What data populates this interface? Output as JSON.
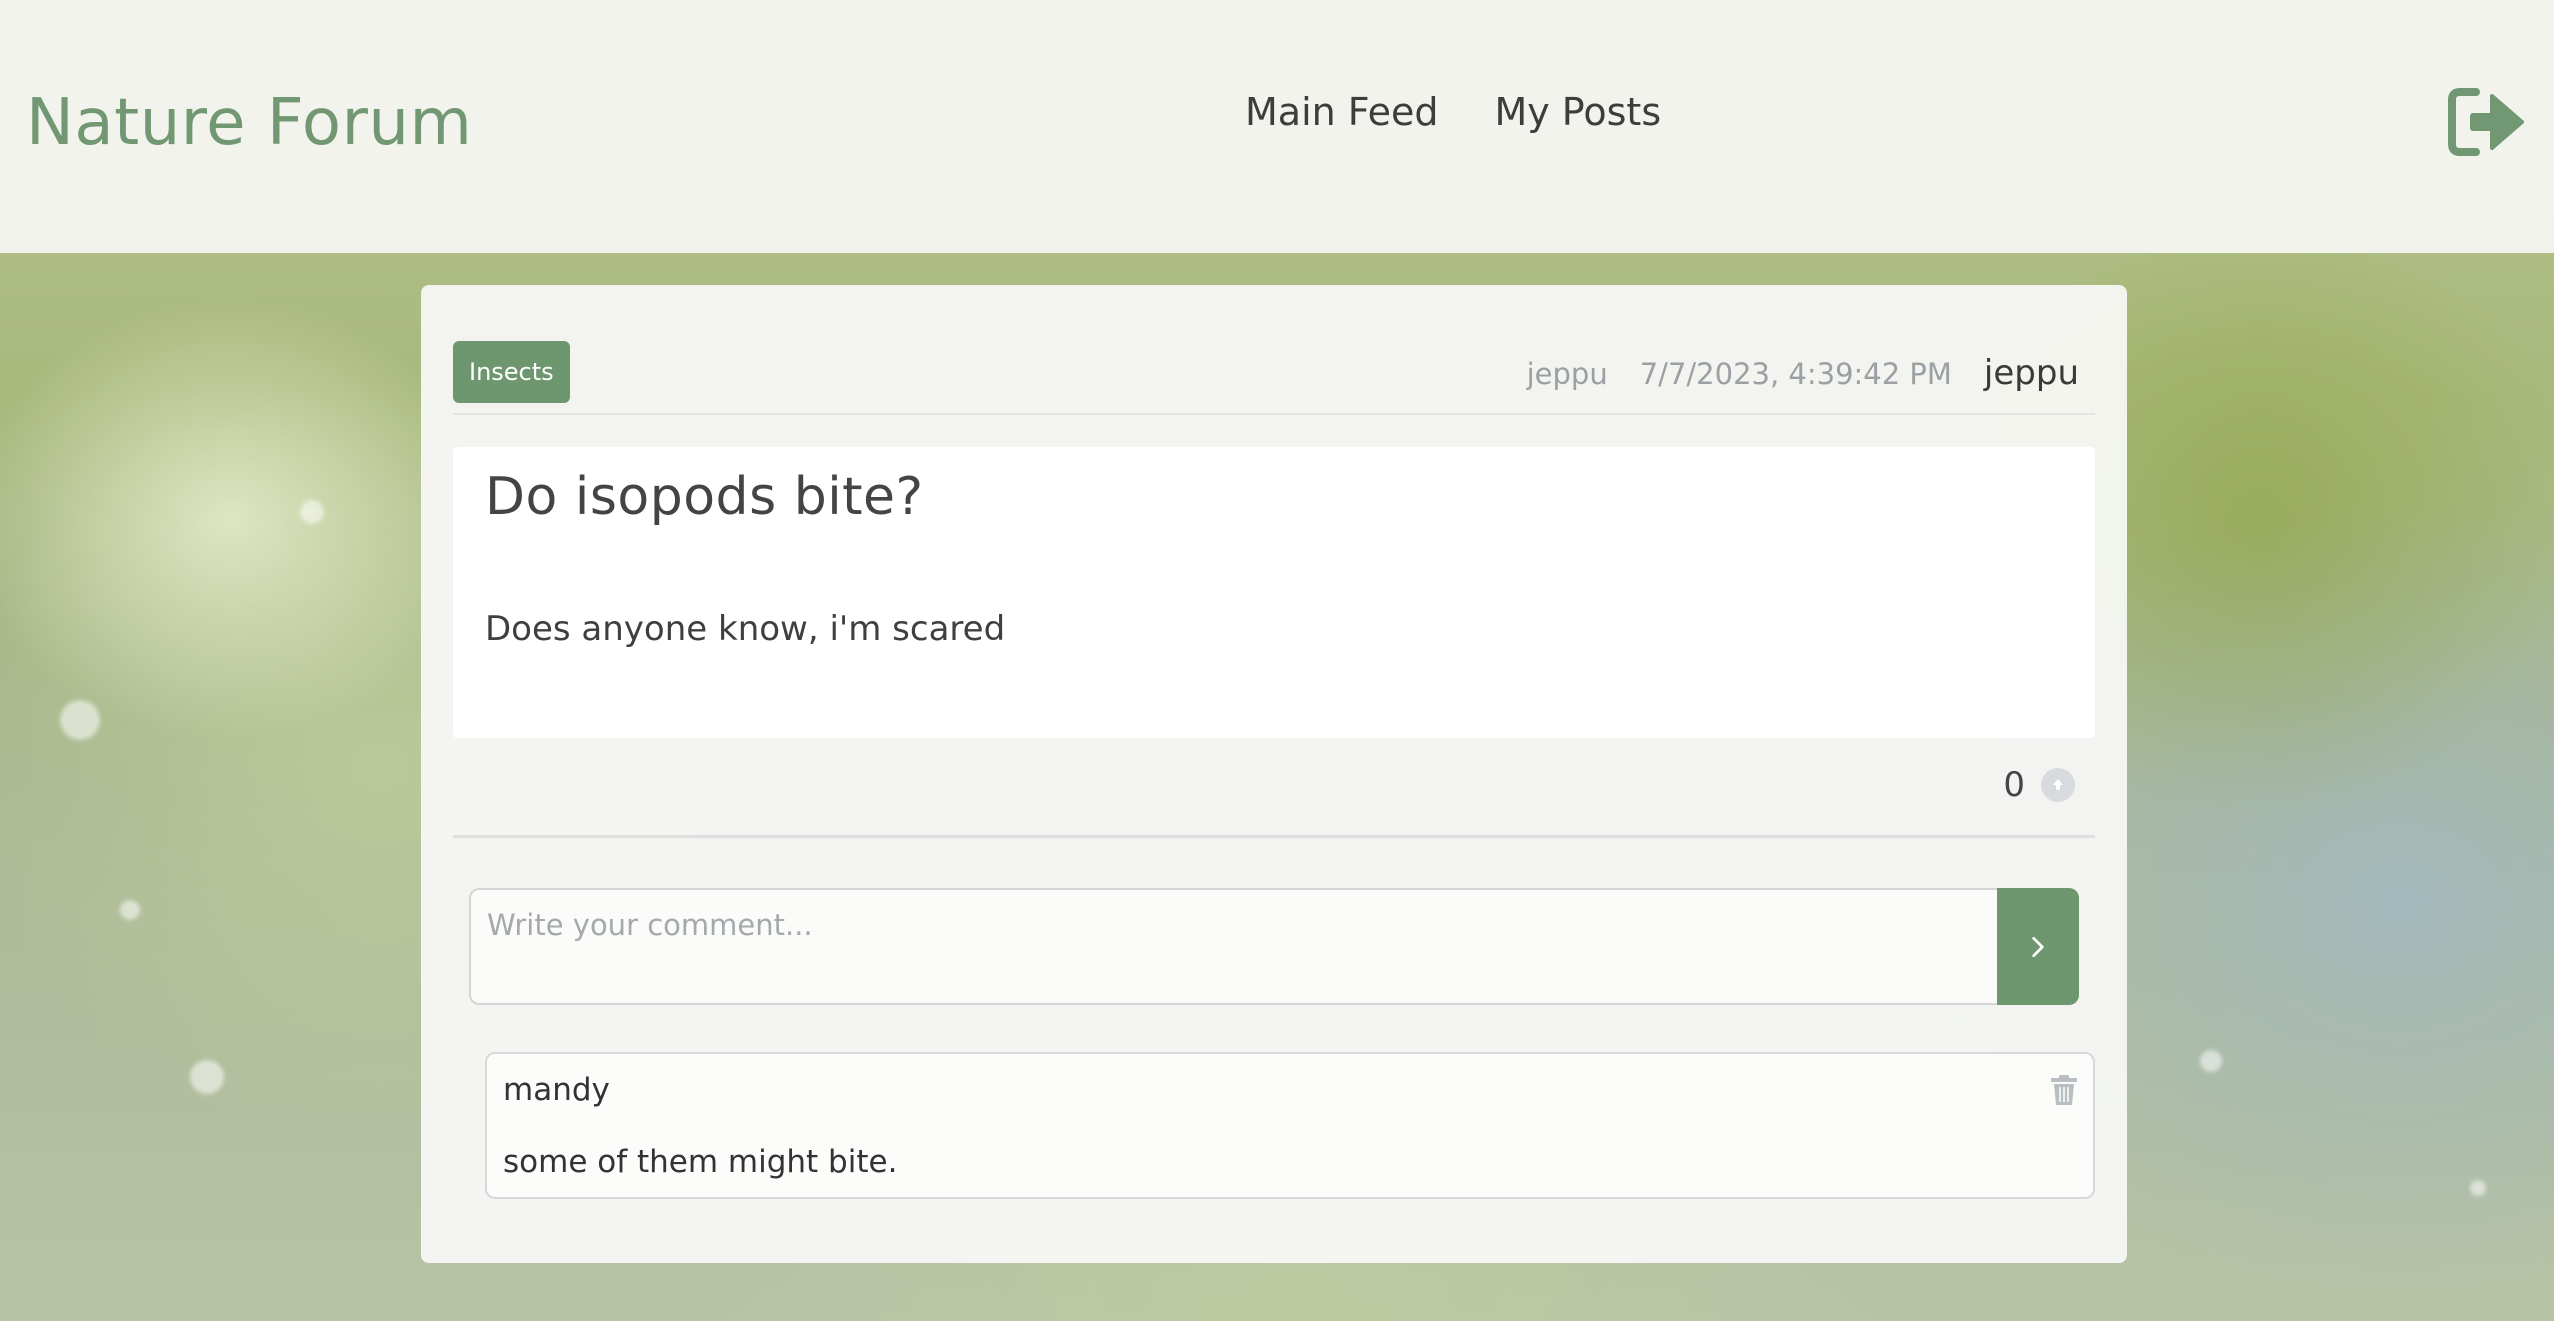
{
  "header": {
    "brand": "Nature Forum",
    "nav": [
      {
        "label": "Main Feed"
      },
      {
        "label": "My Posts"
      }
    ],
    "logout_icon": "sign-out-icon"
  },
  "post": {
    "category": "Insects",
    "author": "jeppu",
    "date": "7/7/2023, 4:39:42 PM",
    "current_user": "jeppu",
    "title": "Do isopods bite?",
    "body": "Does anyone know, i'm scared",
    "votes": "0",
    "upvote_icon": "arrow-up-circle-icon"
  },
  "comment_form": {
    "placeholder": "Write your comment...",
    "submit_icon": "chevron-right-icon"
  },
  "comments": [
    {
      "author": "mandy",
      "text": "some of them might bite.",
      "delete_icon": "trash-icon"
    }
  ],
  "colors": {
    "accent": "#6f976f",
    "brand": "#719873"
  }
}
